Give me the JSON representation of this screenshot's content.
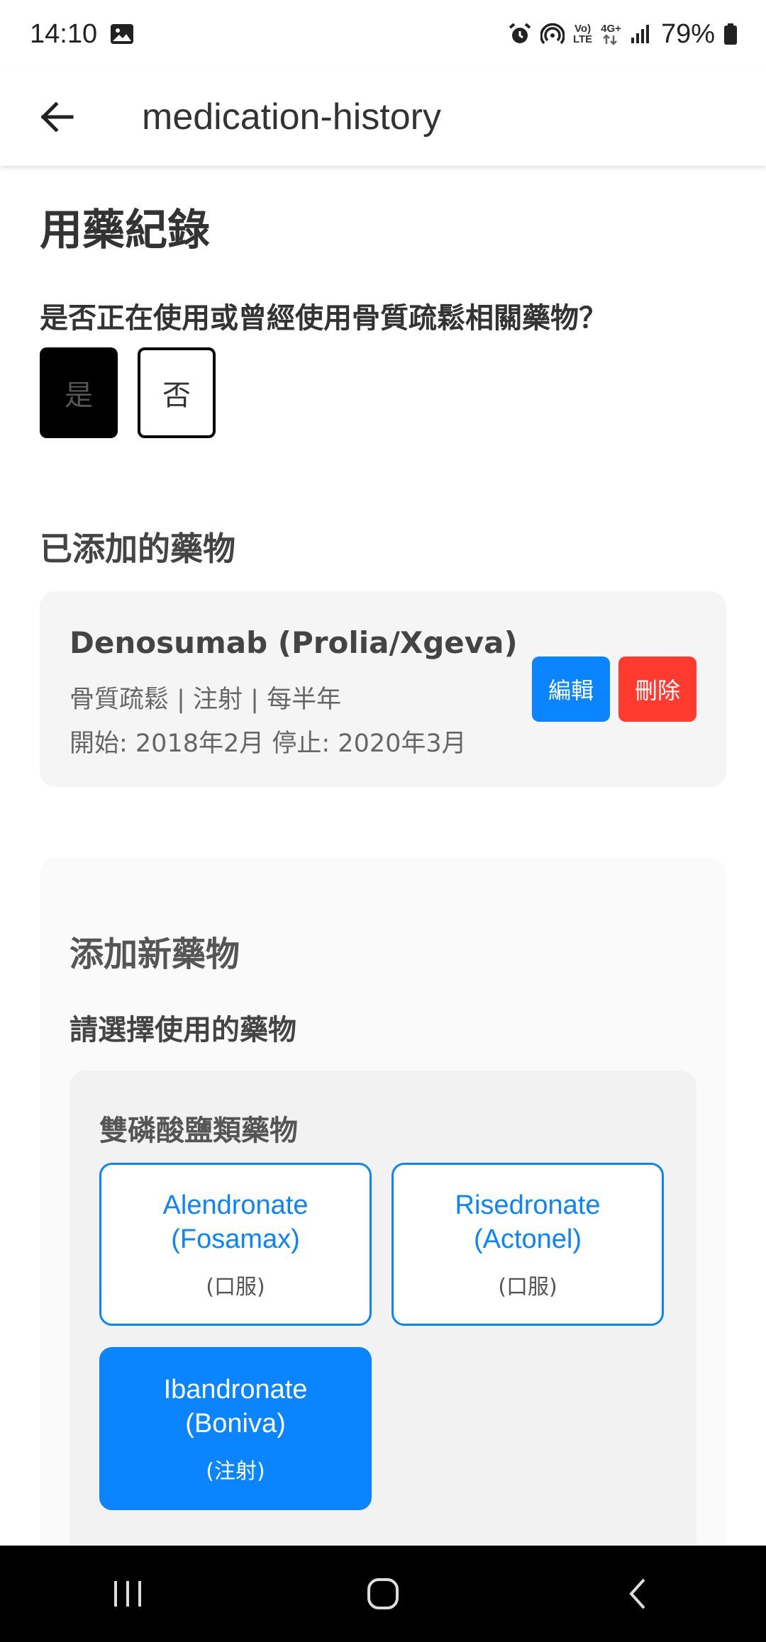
{
  "status_bar": {
    "time": "14:10",
    "battery": "79%",
    "lte_top": "Vo)",
    "lte_bottom": "LTE",
    "net": "4G+"
  },
  "app_bar": {
    "title": "medication-history"
  },
  "page": {
    "title": "用藥紀錄",
    "question": "是否正在使用或曾經使用骨質疏鬆相關藥物？",
    "yes_label": "是",
    "no_label": "否",
    "added_section_title": "已添加的藥物"
  },
  "medication": {
    "name": "Denosumab (Prolia/Xgeva)",
    "detail": "骨質疏鬆 | 注射 | 每半年",
    "dates": "開始: 2018年2月 停止: 2020年3月",
    "edit_label": "編輯",
    "delete_label": "刪除"
  },
  "add_new": {
    "title": "添加新藥物",
    "select_label": "請選擇使用的藥物",
    "category": "雙磷酸鹽類藥物",
    "options": [
      {
        "line1": "Alendronate",
        "line2": "(Fosamax)",
        "route": "(口服)",
        "selected": false
      },
      {
        "line1": "Risedronate",
        "line2": "(Actonel)",
        "route": "(口服)",
        "selected": false
      },
      {
        "line1": "Ibandronate",
        "line2": "(Boniva)",
        "route": "(注射)",
        "selected": true
      }
    ]
  },
  "colors": {
    "accent": "#0a84ff",
    "danger": "#ff3b30",
    "selected_toggle": "#000000"
  }
}
